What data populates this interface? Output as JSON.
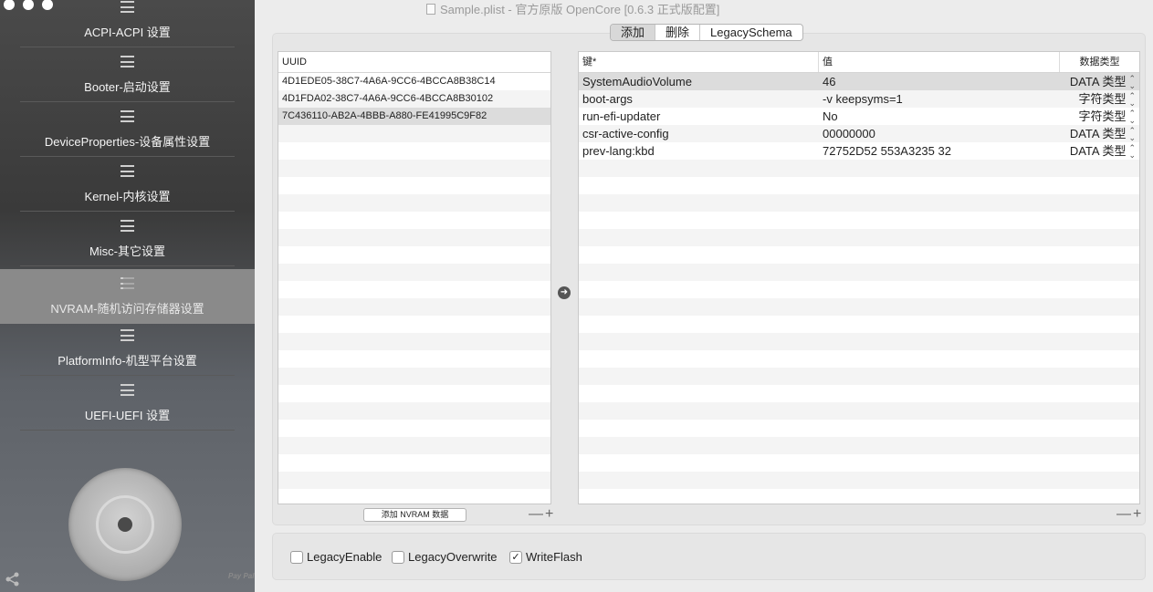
{
  "window": {
    "title": "Sample.plist - 官方原版 OpenCore [0.6.3 正式版配置]"
  },
  "sidebar": {
    "items": [
      {
        "label": "ACPI-ACPI 设置",
        "icon": "list-icon"
      },
      {
        "label": "Booter-启动设置",
        "icon": "list-icon"
      },
      {
        "label": "DeviceProperties-设备属性设置",
        "icon": "list-icon"
      },
      {
        "label": "Kernel-内核设置",
        "icon": "list-icon"
      },
      {
        "label": "Misc-其它设置",
        "icon": "list-icon"
      },
      {
        "label": "NVRAM-随机访问存储器设置",
        "icon": "list-icon",
        "active": true
      },
      {
        "label": "PlatformInfo-机型平台设置",
        "icon": "list-icon"
      },
      {
        "label": "UEFI-UEFI 设置",
        "icon": "list-icon"
      }
    ],
    "paypal": "Pay Pal"
  },
  "segmented": {
    "add": "添加",
    "delete": "删除",
    "legacy": "LegacySchema",
    "selected": "add"
  },
  "uuid_table": {
    "header": "UUID",
    "rows": [
      "4D1EDE05-38C7-4A6A-9CC6-4BCCA8B38C14",
      "4D1FDA02-38C7-4A6A-9CC6-4BCCA8B30102",
      "7C436110-AB2A-4BBB-A880-FE41995C9F82"
    ],
    "selected_index": 2,
    "add_button": "添加 NVRAM 数据",
    "plus_minus": "—+"
  },
  "kv_table": {
    "headers": {
      "key": "键*",
      "value": "值",
      "type": "数据类型"
    },
    "rows": [
      {
        "key": "SystemAudioVolume",
        "value": "46",
        "type": "DATA 类型"
      },
      {
        "key": "boot-args",
        "value": "-v keepsyms=1",
        "type": "字符类型"
      },
      {
        "key": "run-efi-updater",
        "value": "No",
        "type": "字符类型"
      },
      {
        "key": "csr-active-config",
        "value": "00000000",
        "type": "DATA 类型"
      },
      {
        "key": "prev-lang:kbd",
        "value": "72752D52 553A3235 32",
        "type": "DATA 类型"
      }
    ],
    "selected_index": 0,
    "plus_minus": "—+"
  },
  "options": {
    "legacy_enable": {
      "label": "LegacyEnable",
      "checked": false
    },
    "legacy_overwrite": {
      "label": "LegacyOverwrite",
      "checked": false
    },
    "write_flash": {
      "label": "WriteFlash",
      "checked": true
    }
  }
}
